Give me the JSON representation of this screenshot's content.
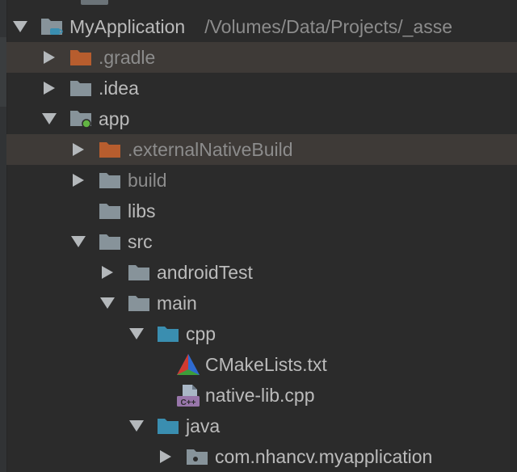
{
  "root": {
    "name": "MyApplication",
    "path": "/Volumes/Data/Projects/_asse"
  },
  "nodes": {
    "gradle": ".gradle",
    "idea": ".idea",
    "app": "app",
    "externalNativeBuild": ".externalNativeBuild",
    "build": "build",
    "libs": "libs",
    "src": "src",
    "androidTest": "androidTest",
    "main": "main",
    "cpp": "cpp",
    "cmakelists": "CMakeLists.txt",
    "nativelib": "native-lib.cpp",
    "java": "java",
    "package": "com.nhancv.myapplication"
  },
  "badges": {
    "cpp_file_badge": "C++"
  },
  "colors": {
    "background": "#2b2b2b",
    "excluded_row": "#3e3a37",
    "folder_gray": "#87939a",
    "folder_excluded": "#b75d2e",
    "folder_source": "#3a8eb0",
    "module_dot": "#62b543",
    "text": "#bbbbbb",
    "text_dim": "#8c8c8c"
  }
}
